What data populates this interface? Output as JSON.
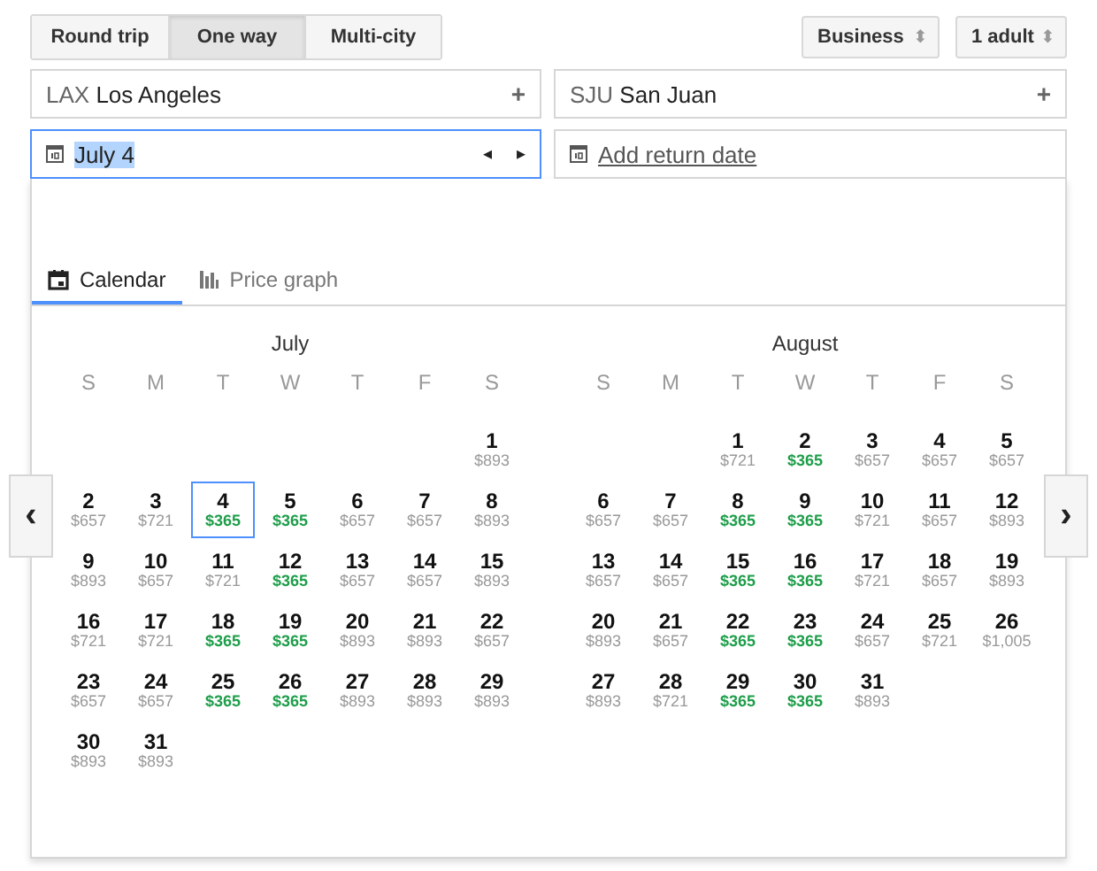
{
  "trip_types": [
    {
      "label": "Round trip",
      "selected": false
    },
    {
      "label": "One way",
      "selected": true
    },
    {
      "label": "Multi-city",
      "selected": false
    }
  ],
  "selects": [
    {
      "value": "Business",
      "arrows": "⬍"
    },
    {
      "value": "1 adult",
      "arrows": "⬍"
    }
  ],
  "origin": {
    "code": "LAX",
    "city": "Los Angeles",
    "action": "+"
  },
  "destination": {
    "code": "SJU",
    "city": "San Juan",
    "action": "+"
  },
  "depart_date": {
    "value": "July 4",
    "focused": true,
    "prev": "◂",
    "next": "▸"
  },
  "return_date": {
    "link": "Add return date"
  },
  "tabs": [
    {
      "label": "Calendar",
      "selected": true
    },
    {
      "label": "Price graph",
      "selected": false
    }
  ],
  "nav": {
    "prev": "‹",
    "next": "›"
  },
  "months": [
    {
      "name": "July",
      "weekdays": [
        "S",
        "M",
        "T",
        "W",
        "T",
        "F",
        "S"
      ],
      "weeks": [
        [
          {
            "kind": "empty"
          },
          {
            "kind": "empty"
          },
          {
            "kind": "empty"
          },
          {
            "kind": "empty"
          },
          {
            "kind": "empty"
          },
          {
            "kind": "empty"
          },
          {
            "kind": "day",
            "day": "1",
            "price": "$893",
            "cheap": false,
            "selected": false
          }
        ],
        [
          {
            "kind": "day",
            "day": "2",
            "price": "$657",
            "cheap": false,
            "selected": false
          },
          {
            "kind": "day",
            "day": "3",
            "price": "$721",
            "cheap": false,
            "selected": false
          },
          {
            "kind": "day",
            "day": "4",
            "price": "$365",
            "cheap": true,
            "selected": true
          },
          {
            "kind": "day",
            "day": "5",
            "price": "$365",
            "cheap": true,
            "selected": false
          },
          {
            "kind": "day",
            "day": "6",
            "price": "$657",
            "cheap": false,
            "selected": false
          },
          {
            "kind": "day",
            "day": "7",
            "price": "$657",
            "cheap": false,
            "selected": false
          },
          {
            "kind": "day",
            "day": "8",
            "price": "$893",
            "cheap": false,
            "selected": false
          }
        ],
        [
          {
            "kind": "day",
            "day": "9",
            "price": "$893",
            "cheap": false,
            "selected": false
          },
          {
            "kind": "day",
            "day": "10",
            "price": "$657",
            "cheap": false,
            "selected": false
          },
          {
            "kind": "day",
            "day": "11",
            "price": "$721",
            "cheap": false,
            "selected": false
          },
          {
            "kind": "day",
            "day": "12",
            "price": "$365",
            "cheap": true,
            "selected": false
          },
          {
            "kind": "day",
            "day": "13",
            "price": "$657",
            "cheap": false,
            "selected": false
          },
          {
            "kind": "day",
            "day": "14",
            "price": "$657",
            "cheap": false,
            "selected": false
          },
          {
            "kind": "day",
            "day": "15",
            "price": "$893",
            "cheap": false,
            "selected": false
          }
        ],
        [
          {
            "kind": "day",
            "day": "16",
            "price": "$721",
            "cheap": false,
            "selected": false
          },
          {
            "kind": "day",
            "day": "17",
            "price": "$721",
            "cheap": false,
            "selected": false
          },
          {
            "kind": "day",
            "day": "18",
            "price": "$365",
            "cheap": true,
            "selected": false
          },
          {
            "kind": "day",
            "day": "19",
            "price": "$365",
            "cheap": true,
            "selected": false
          },
          {
            "kind": "day",
            "day": "20",
            "price": "$893",
            "cheap": false,
            "selected": false
          },
          {
            "kind": "day",
            "day": "21",
            "price": "$893",
            "cheap": false,
            "selected": false
          },
          {
            "kind": "day",
            "day": "22",
            "price": "$657",
            "cheap": false,
            "selected": false
          }
        ],
        [
          {
            "kind": "day",
            "day": "23",
            "price": "$657",
            "cheap": false,
            "selected": false
          },
          {
            "kind": "day",
            "day": "24",
            "price": "$657",
            "cheap": false,
            "selected": false
          },
          {
            "kind": "day",
            "day": "25",
            "price": "$365",
            "cheap": true,
            "selected": false
          },
          {
            "kind": "day",
            "day": "26",
            "price": "$365",
            "cheap": true,
            "selected": false
          },
          {
            "kind": "day",
            "day": "27",
            "price": "$893",
            "cheap": false,
            "selected": false
          },
          {
            "kind": "day",
            "day": "28",
            "price": "$893",
            "cheap": false,
            "selected": false
          },
          {
            "kind": "day",
            "day": "29",
            "price": "$893",
            "cheap": false,
            "selected": false
          }
        ],
        [
          {
            "kind": "day",
            "day": "30",
            "price": "$893",
            "cheap": false,
            "selected": false
          },
          {
            "kind": "day",
            "day": "31",
            "price": "$893",
            "cheap": false,
            "selected": false
          }
        ]
      ]
    },
    {
      "name": "August",
      "weekdays": [
        "S",
        "M",
        "T",
        "W",
        "T",
        "F",
        "S"
      ],
      "weeks": [
        [
          {
            "kind": "empty"
          },
          {
            "kind": "empty"
          },
          {
            "kind": "day",
            "day": "1",
            "price": "$721",
            "cheap": false,
            "selected": false
          },
          {
            "kind": "day",
            "day": "2",
            "price": "$365",
            "cheap": true,
            "selected": false
          },
          {
            "kind": "day",
            "day": "3",
            "price": "$657",
            "cheap": false,
            "selected": false
          },
          {
            "kind": "day",
            "day": "4",
            "price": "$657",
            "cheap": false,
            "selected": false
          },
          {
            "kind": "day",
            "day": "5",
            "price": "$657",
            "cheap": false,
            "selected": false
          }
        ],
        [
          {
            "kind": "day",
            "day": "6",
            "price": "$657",
            "cheap": false,
            "selected": false
          },
          {
            "kind": "day",
            "day": "7",
            "price": "$657",
            "cheap": false,
            "selected": false
          },
          {
            "kind": "day",
            "day": "8",
            "price": "$365",
            "cheap": true,
            "selected": false
          },
          {
            "kind": "day",
            "day": "9",
            "price": "$365",
            "cheap": true,
            "selected": false
          },
          {
            "kind": "day",
            "day": "10",
            "price": "$721",
            "cheap": false,
            "selected": false
          },
          {
            "kind": "day",
            "day": "11",
            "price": "$657",
            "cheap": false,
            "selected": false
          },
          {
            "kind": "day",
            "day": "12",
            "price": "$893",
            "cheap": false,
            "selected": false
          }
        ],
        [
          {
            "kind": "day",
            "day": "13",
            "price": "$657",
            "cheap": false,
            "selected": false
          },
          {
            "kind": "day",
            "day": "14",
            "price": "$657",
            "cheap": false,
            "selected": false
          },
          {
            "kind": "day",
            "day": "15",
            "price": "$365",
            "cheap": true,
            "selected": false
          },
          {
            "kind": "day",
            "day": "16",
            "price": "$365",
            "cheap": true,
            "selected": false
          },
          {
            "kind": "day",
            "day": "17",
            "price": "$721",
            "cheap": false,
            "selected": false
          },
          {
            "kind": "day",
            "day": "18",
            "price": "$657",
            "cheap": false,
            "selected": false
          },
          {
            "kind": "day",
            "day": "19",
            "price": "$893",
            "cheap": false,
            "selected": false
          }
        ],
        [
          {
            "kind": "day",
            "day": "20",
            "price": "$893",
            "cheap": false,
            "selected": false
          },
          {
            "kind": "day",
            "day": "21",
            "price": "$657",
            "cheap": false,
            "selected": false
          },
          {
            "kind": "day",
            "day": "22",
            "price": "$365",
            "cheap": true,
            "selected": false
          },
          {
            "kind": "day",
            "day": "23",
            "price": "$365",
            "cheap": true,
            "selected": false
          },
          {
            "kind": "day",
            "day": "24",
            "price": "$657",
            "cheap": false,
            "selected": false
          },
          {
            "kind": "day",
            "day": "25",
            "price": "$721",
            "cheap": false,
            "selected": false
          },
          {
            "kind": "day",
            "day": "26",
            "price": "$1,005",
            "cheap": false,
            "selected": false
          }
        ],
        [
          {
            "kind": "day",
            "day": "27",
            "price": "$893",
            "cheap": false,
            "selected": false
          },
          {
            "kind": "day",
            "day": "28",
            "price": "$721",
            "cheap": false,
            "selected": false
          },
          {
            "kind": "day",
            "day": "29",
            "price": "$365",
            "cheap": true,
            "selected": false
          },
          {
            "kind": "day",
            "day": "30",
            "price": "$365",
            "cheap": true,
            "selected": false
          },
          {
            "kind": "day",
            "day": "31",
            "price": "$893",
            "cheap": false,
            "selected": false
          }
        ]
      ]
    }
  ]
}
